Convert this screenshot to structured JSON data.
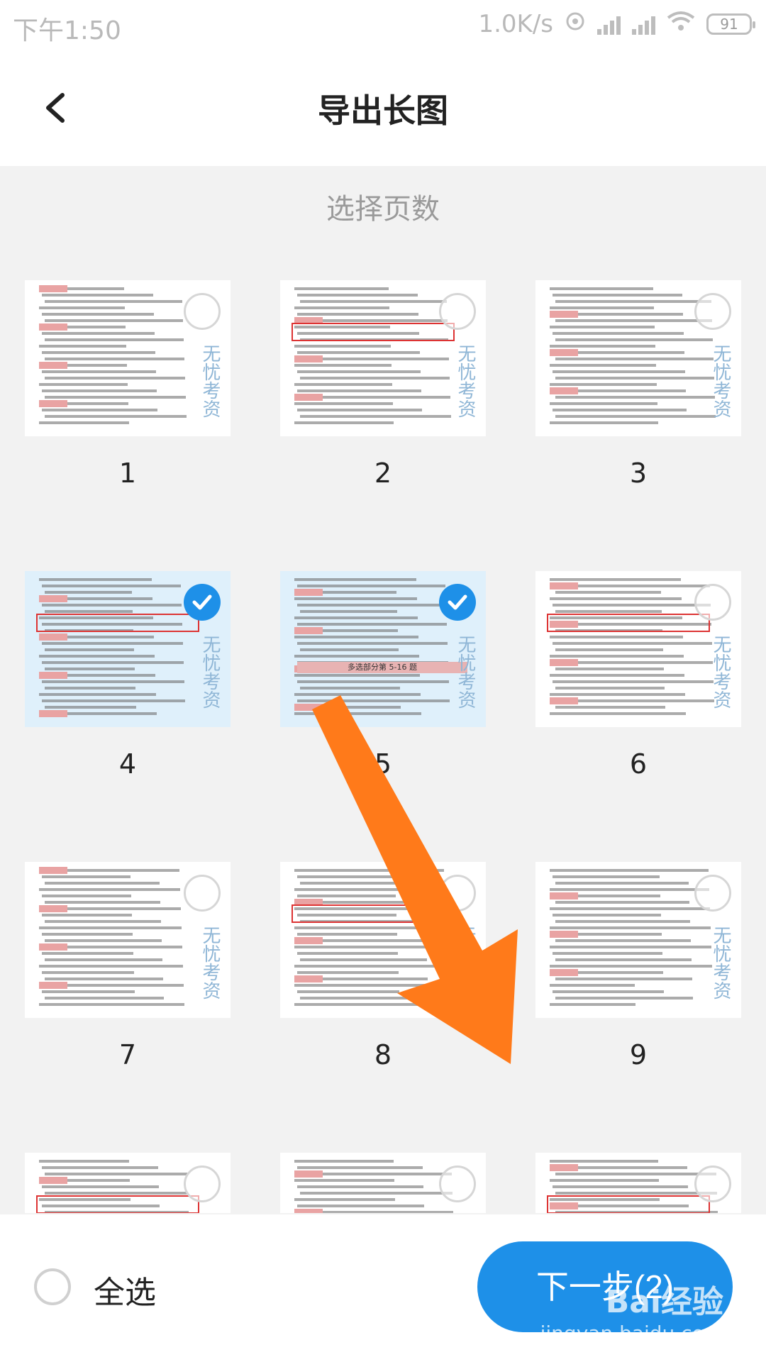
{
  "status_bar": {
    "time": "下午1:50",
    "net_speed": "1.0K/s",
    "battery": "91"
  },
  "header": {
    "title": "导出长图"
  },
  "subheader": "选择页数",
  "pages": [
    {
      "num": "1",
      "selected": false
    },
    {
      "num": "2",
      "selected": false
    },
    {
      "num": "3",
      "selected": false
    },
    {
      "num": "4",
      "selected": true
    },
    {
      "num": "5",
      "selected": true
    },
    {
      "num": "6",
      "selected": false
    },
    {
      "num": "7",
      "selected": false
    },
    {
      "num": "8",
      "selected": false
    },
    {
      "num": "9",
      "selected": false
    },
    {
      "num": "",
      "selected": false
    },
    {
      "num": "",
      "selected": false
    },
    {
      "num": "",
      "selected": false
    }
  ],
  "thumb_watermark": "无忧考资",
  "page5_banner": "多选部分第 5-16 题",
  "bottom_bar": {
    "select_all_label": "全选",
    "next_label": "下一步(2)"
  },
  "watermark": {
    "brand": "Bai经验",
    "url": "jingyan.baidu.com"
  },
  "colors": {
    "accent": "#1e90e8",
    "arrow": "#ff7a1a"
  }
}
